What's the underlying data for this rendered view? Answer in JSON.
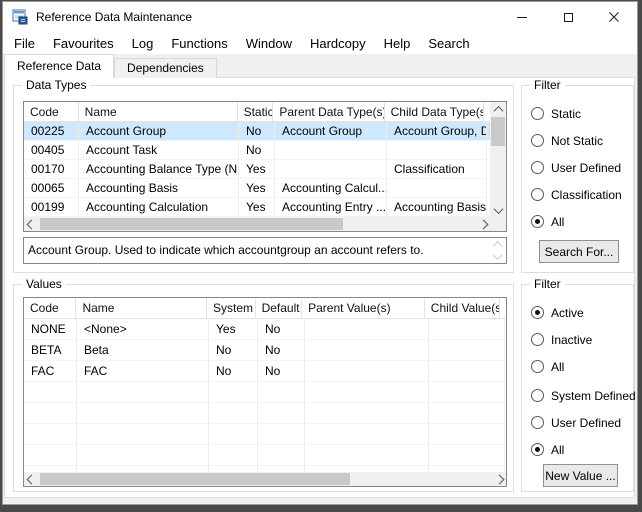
{
  "window": {
    "title": "Reference Data Maintenance",
    "icons": {
      "app_icon": "form-window",
      "minimize_icon": "thin-dash",
      "maximize_icon": "hollow-square",
      "close_icon": "x-cross"
    }
  },
  "menu": {
    "items": [
      "File",
      "Favourites",
      "Log",
      "Functions",
      "Window",
      "Hardcopy",
      "Help",
      "Search"
    ]
  },
  "tabs": [
    {
      "label": "Reference Data",
      "active": true
    },
    {
      "label": "Dependencies",
      "active": false
    }
  ],
  "data_types": {
    "group_label": "Data Types",
    "columns": [
      "Code",
      "Name",
      "Static",
      "Parent Data Type(s)",
      "Child Data Type(s)"
    ],
    "rows": [
      [
        "00225",
        "Account Group",
        "No",
        "Account Group",
        "Account Group, D.."
      ],
      [
        "00405",
        "Account Task",
        "No",
        "",
        ""
      ],
      [
        "00170",
        "Accounting Balance Type (N...",
        "Yes",
        "",
        "Classification"
      ],
      [
        "00065",
        "Accounting Basis",
        "Yes",
        "Accounting Calcul...",
        ""
      ],
      [
        "00199",
        "Accounting Calculation",
        "Yes",
        "Accounting Entry ...",
        "Accounting Basis"
      ]
    ],
    "selected_row_index": 0,
    "description": "Account Group. Used to indicate which accountgroup an account refers to."
  },
  "filter_data_types": {
    "label": "Filter",
    "options": [
      {
        "label": "Static",
        "selected": false
      },
      {
        "label": "Not Static",
        "selected": false
      },
      {
        "label": "User Defined",
        "selected": false
      },
      {
        "label": "Classification",
        "selected": false
      },
      {
        "label": "All",
        "selected": true
      }
    ],
    "button_label": "Search For..."
  },
  "values": {
    "group_label": "Values",
    "columns": [
      "Code",
      "Name",
      "System",
      "Default",
      "Parent Value(s)",
      "Child Value(s)"
    ],
    "rows": [
      [
        "NONE",
        "<None>",
        "Yes",
        "No",
        "",
        ""
      ],
      [
        "BETA",
        "Beta",
        "No",
        "No",
        "",
        ""
      ],
      [
        "FAC",
        "FAC",
        "No",
        "No",
        "",
        ""
      ]
    ],
    "selected_row_index": -1
  },
  "filter_values": {
    "label": "Filter",
    "status_options": [
      {
        "label": "Active",
        "selected": true
      },
      {
        "label": "Inactive",
        "selected": false
      },
      {
        "label": "All",
        "selected": false
      }
    ],
    "defined_options": [
      {
        "label": "System Defined",
        "selected": false
      },
      {
        "label": "User Defined",
        "selected": false
      },
      {
        "label": "All",
        "selected": true
      }
    ],
    "button_label": "New Value ..."
  },
  "colors": {
    "selection_highlight": "#cde8ff",
    "window_bg": "#f0f0f0",
    "panel_bg": "#ffffff",
    "titlebar_bg": "#ffffff",
    "app_icon_blue": "#3f6fb0"
  }
}
